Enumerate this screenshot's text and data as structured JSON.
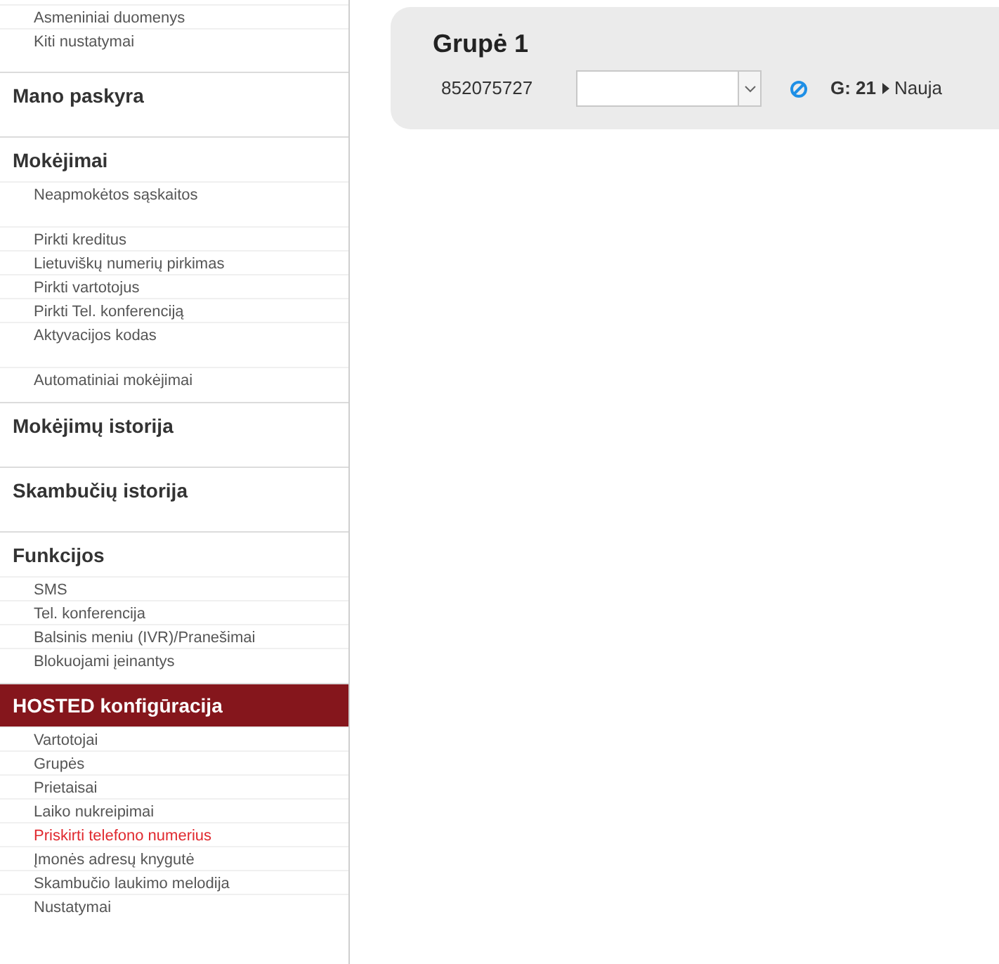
{
  "sidebar": {
    "sections": [
      {
        "groups": [
          [
            {
              "label": "Asmeniniai duomenys",
              "selected": false
            },
            {
              "label": "Kiti nustatymai",
              "selected": false
            }
          ]
        ]
      },
      {
        "title": "Mano paskyra",
        "active": false
      },
      {
        "title": "Mokėjimai",
        "active": false,
        "groups": [
          [
            {
              "label": "Neapmokėtos sąskaitos",
              "selected": false
            }
          ],
          [
            {
              "label": "Pirkti kreditus",
              "selected": false
            },
            {
              "label": "Lietuviškų numerių pirkimas",
              "selected": false
            },
            {
              "label": "Pirkti vartotojus",
              "selected": false
            },
            {
              "label": "Pirkti Tel. konferenciją",
              "selected": false
            },
            {
              "label": "Aktyvacijos kodas",
              "selected": false
            }
          ],
          [
            {
              "label": "Automatiniai mokėjimai",
              "selected": false
            }
          ]
        ]
      },
      {
        "title": "Mokėjimų istorija",
        "active": false
      },
      {
        "title": "Skambučių istorija",
        "active": false
      },
      {
        "title": "Funkcijos",
        "active": false,
        "groups": [
          [
            {
              "label": "SMS",
              "selected": false
            },
            {
              "label": "Tel. konferencija",
              "selected": false
            },
            {
              "label": "Balsinis meniu (IVR)/Pranešimai",
              "selected": false
            },
            {
              "label": "Blokuojami įeinantys",
              "selected": false
            }
          ]
        ]
      },
      {
        "title": "HOSTED konfigūracija",
        "active": true,
        "groups": [
          [
            {
              "label": "Vartotojai",
              "selected": false
            },
            {
              "label": "Grupės",
              "selected": false
            },
            {
              "label": "Prietaisai",
              "selected": false
            },
            {
              "label": "Laiko nukreipimai",
              "selected": false
            },
            {
              "label": "Priskirti telefono numerius",
              "selected": true
            },
            {
              "label": "Įmonės adresų knygutė",
              "selected": false
            },
            {
              "label": "Skambučio laukimo melodija",
              "selected": false
            },
            {
              "label": "Nustatymai",
              "selected": false
            }
          ]
        ]
      }
    ]
  },
  "group_panel": {
    "title": "Grupė 1",
    "number": "852075727",
    "count": "G: 21",
    "status": "Nauja"
  }
}
